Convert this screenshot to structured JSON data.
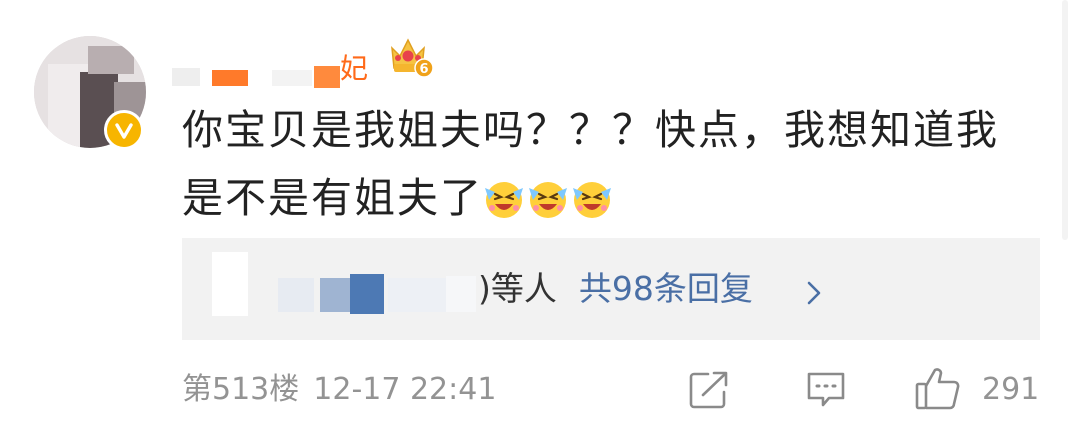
{
  "comment": {
    "username_visible_suffix": "妃",
    "level_badge": "6",
    "text_line1": "你宝贝是我姐夫吗？？？快点，我想知道我",
    "text_line2": "是不是有姐夫了",
    "emoji": [
      "laugh-cry-emoji",
      "laugh-cry-emoji",
      "laugh-cry-emoji"
    ]
  },
  "replies": {
    "suffix": ")等人",
    "count_label": "共98条回复"
  },
  "footer": {
    "floor": "第513楼",
    "timestamp": "12-17 22:41",
    "like_count": "291"
  },
  "colors": {
    "link_blue": "#4a6fa5",
    "meta_gray": "#939393",
    "text_dark": "#222222",
    "verified_badge": "#f7b500",
    "username_orange": "#ff6a1a"
  },
  "icons": [
    "verified-badge-icon",
    "crown-level-icon",
    "share-icon",
    "comment-icon",
    "like-icon",
    "chevron-right-icon"
  ]
}
